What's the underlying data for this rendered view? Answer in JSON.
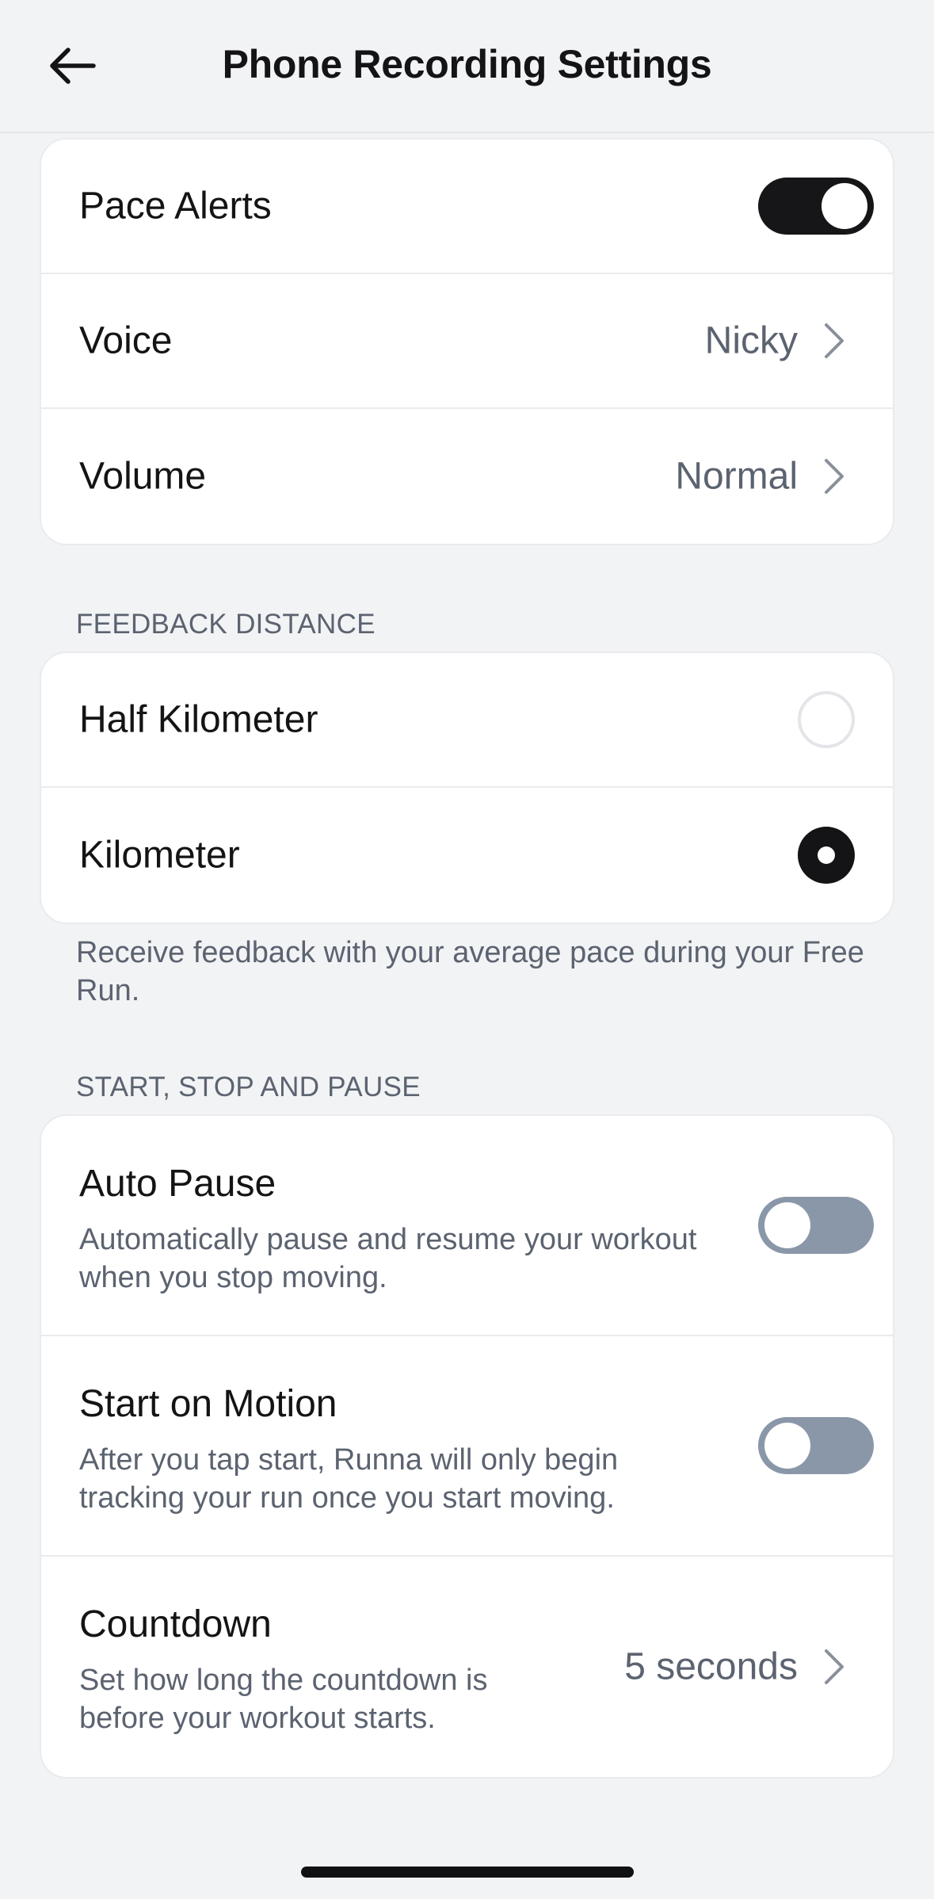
{
  "header": {
    "title": "Phone Recording Settings",
    "back_icon": "arrow-left-icon"
  },
  "audio_settings": {
    "pace_alerts": {
      "label": "Pace Alerts",
      "enabled": true
    },
    "voice": {
      "label": "Voice",
      "value": "Nicky"
    },
    "volume": {
      "label": "Volume",
      "value": "Normal"
    }
  },
  "feedback_distance": {
    "header": "FEEDBACK DISTANCE",
    "options": [
      {
        "label": "Half Kilometer",
        "selected": false
      },
      {
        "label": "Kilometer",
        "selected": true
      }
    ],
    "note": "Receive feedback with your average pace during your Free Run."
  },
  "start_stop_pause": {
    "header": "START, STOP AND PAUSE",
    "auto_pause": {
      "title": "Auto Pause",
      "description_line1": "Automatically pause and resume your workout",
      "description_line2": "when you stop moving.",
      "enabled": false
    },
    "start_on_motion": {
      "title": "Start on Motion",
      "description_line1": "After you tap start, Runna will only begin",
      "description_line2": "tracking your run once you start moving.",
      "enabled": false
    },
    "countdown": {
      "title": "Countdown",
      "description_line1": "Set how long the countdown is",
      "description_line2": "before your workout starts.",
      "value": "5 seconds"
    }
  },
  "colors": {
    "background": "#f2f3f5",
    "toggle_on": "#161618",
    "toggle_off": "#8a97a8",
    "secondary_text": "#5c6370"
  }
}
